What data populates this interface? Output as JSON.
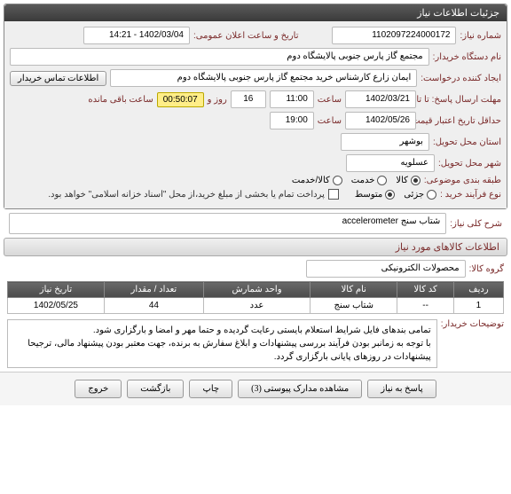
{
  "panel1_title": "جزئیات اطلاعات نیاز",
  "labels": {
    "need_no": "شماره نیاز:",
    "buyer_org": "نام دستگاه خریدار:",
    "requester": "ایجاد کننده درخواست:",
    "deadline": "مهلت ارسال پاسخ: تا تاریخ:",
    "price_validity": "حداقل تاریخ اعتبار قیمت: تا تاریخ:",
    "delivery_province": "استان محل تحویل:",
    "delivery_city": "شهر محل تحویل:",
    "category": "طبقه بندی موضوعی:",
    "process_type": "نوع فرآیند خرید :",
    "public_date": "تاریخ و ساعت اعلان عمومی:",
    "time": "ساعت",
    "day_and": "روز و",
    "time_remain": "ساعت باقی مانده",
    "contact_btn": "اطلاعات تماس خریدار",
    "pay_note": "پرداخت تمام یا بخشی از مبلغ خرید،از محل \"اسناد خزانه اسلامی\" خواهد بود.",
    "general_desc": "شرح کلی نیاز:",
    "goods_header": "اطلاعات کالاهای مورد نیاز",
    "goods_group": "گروه کالا:",
    "notes": "توضیحات خریدار:"
  },
  "values": {
    "need_no": "1102097224000172",
    "buyer_org": "مجتمع گاز پارس جنوبی  پالایشگاه دوم",
    "requester": "ایمان زارع کارشناس خرید مجتمع گاز پارس جنوبی  پالایشگاه دوم",
    "deadline_date": "1402/03/21",
    "deadline_time": "11:00",
    "days_left": "16",
    "countdown": "00:50:07",
    "validity_date": "1402/05/26",
    "validity_time": "19:00",
    "province": "بوشهر",
    "city": "عسلویه",
    "public_date": "1402/03/04 - 14:21",
    "desc": "شتاب سنج accelerometer",
    "goods_group": "محصولات الکترونیکی",
    "note_text": "تمامی بندهای فایل شرایط استعلام بایستی رعایت گردیده و حتما مهر و امضا و بارگزاری شود.\nبا توجه به زمانبر بودن فرآیند بررسی پیشنهادات و ابلاغ سفارش به برنده، جهت معتبر بودن پیشنهاد مالی، ترجیحا پیشنهادات در روزهای پایانی بارگزاری گردد."
  },
  "radios": {
    "category": [
      {
        "label": "کالا",
        "selected": true
      },
      {
        "label": "خدمت",
        "selected": false
      },
      {
        "label": "کالا/خدمت",
        "selected": false
      }
    ],
    "process": [
      {
        "label": "جزئی",
        "selected": false
      },
      {
        "label": "متوسط",
        "selected": true
      }
    ]
  },
  "table": {
    "headers": [
      "ردیف",
      "کد کالا",
      "نام کالا",
      "واحد شمارش",
      "تعداد / مقدار",
      "تاریخ نیاز"
    ],
    "rows": [
      {
        "idx": "1",
        "code": "--",
        "name": "شتاب سنج",
        "unit": "عدد",
        "qty": "44",
        "date": "1402/05/25"
      }
    ]
  },
  "footer": {
    "respond": "پاسخ به نیاز",
    "view_docs": "مشاهده مدارک پیوستی (3)",
    "print": "چاپ",
    "back": "بازگشت",
    "exit": "خروج"
  }
}
